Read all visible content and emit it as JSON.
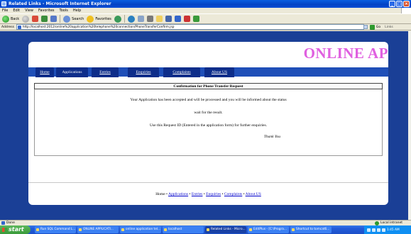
{
  "window": {
    "title": "Related Links - Microsoft Internet Explorer",
    "buttons": [
      "_",
      "□",
      "×"
    ]
  },
  "menubar": [
    "File",
    "Edit",
    "View",
    "Favorites",
    "Tools",
    "Help"
  ],
  "toolbar": {
    "back_label": "Back",
    "search_label": "Search",
    "favorites_label": "Favorites"
  },
  "address": {
    "label": "Address",
    "url": "http://localhost:2012/online%20application%20telephone%20connection/PhoneTransferConfirm.jsp",
    "go_label": "Go",
    "links_label": "Links"
  },
  "page": {
    "brand": "ONLINE AP",
    "nav_tabs": [
      "Home",
      "Applications",
      "Entries",
      "Enquiries",
      "Complaints",
      "About US"
    ],
    "confirmation_title": "Confirmation for Phone Transfer Request",
    "messages": [
      "Your Application has been accepted and will be processed and you will be informed about the status",
      "wait for the result.",
      "Use this Request ID (Entered in the application form) for further enquiries."
    ],
    "thank_you": "Thank You",
    "footer_links": [
      "Home",
      "Applications",
      "Entries",
      "Enquiries",
      "Complaints",
      "About US"
    ],
    "footer_separator": "•"
  },
  "statusbar": {
    "left": "Done",
    "right": "Local intranet"
  },
  "taskbar": {
    "start_label": "start",
    "tasks": [
      "Run SQL Command L...",
      "ONLINE APPLICATI...",
      "online application tel...",
      "localhost",
      "Related Links - Micro...",
      "EditPlus - [C:\\Progra...",
      "Shortcut to tomcat6..."
    ],
    "clock": "1:45 AM"
  }
}
